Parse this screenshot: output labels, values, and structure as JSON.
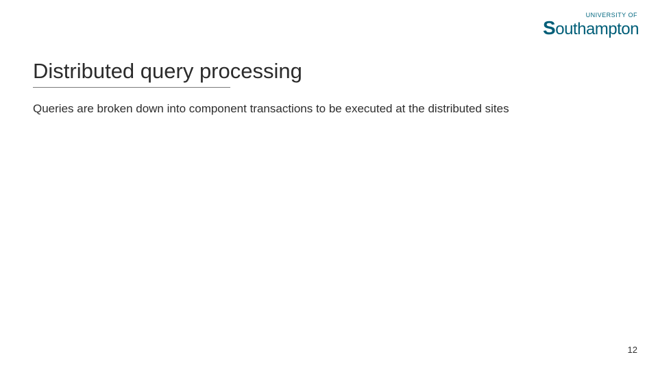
{
  "logo": {
    "top_line": "UNIVERSITY OF",
    "main": "Southampton"
  },
  "title": "Distributed query processing",
  "body_text": "Queries are broken down into component transactions to be executed at the distributed sites",
  "page_number": "12"
}
